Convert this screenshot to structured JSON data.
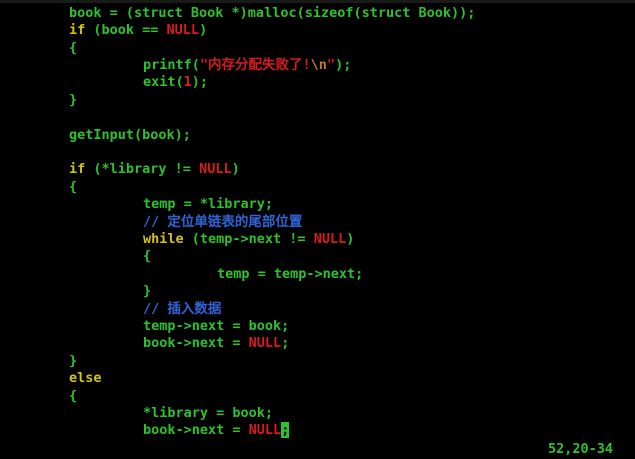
{
  "editor": {
    "lines": [
      {
        "segments": [
          {
            "t": "book = (struct Book *)malloc(",
            "c": "kw-green"
          },
          {
            "t": "sizeof",
            "c": "kw-green"
          },
          {
            "t": "(struct Book));",
            "c": "kw-green"
          }
        ]
      },
      {
        "segments": [
          {
            "t": "if",
            "c": "kw-yellow"
          },
          {
            "t": " (book == ",
            "c": "kw-green"
          },
          {
            "t": "NULL",
            "c": "null-red"
          },
          {
            "t": ")",
            "c": "kw-green"
          }
        ]
      },
      {
        "segments": [
          {
            "t": "{",
            "c": "kw-green"
          }
        ]
      },
      {
        "segments": [
          {
            "t": "printf(",
            "c": "kw-green"
          },
          {
            "t": "\"内存分配失败了!",
            "c": "str-red"
          },
          {
            "t": "\\n",
            "c": "esc"
          },
          {
            "t": "\"",
            "c": "str-red"
          },
          {
            "t": ");",
            "c": "kw-green"
          }
        ]
      },
      {
        "segments": [
          {
            "t": "exit(",
            "c": "kw-green"
          },
          {
            "t": "1",
            "c": "num"
          },
          {
            "t": ");",
            "c": "kw-green"
          }
        ]
      },
      {
        "segments": [
          {
            "t": "}",
            "c": "kw-green"
          }
        ]
      },
      {
        "segments": []
      },
      {
        "segments": [
          {
            "t": "getInput(book);",
            "c": "kw-green"
          }
        ]
      },
      {
        "segments": []
      },
      {
        "segments": [
          {
            "t": "if",
            "c": "kw-yellow"
          },
          {
            "t": " (*library != ",
            "c": "kw-green"
          },
          {
            "t": "NULL",
            "c": "null-red"
          },
          {
            "t": ")",
            "c": "kw-green"
          }
        ]
      },
      {
        "segments": [
          {
            "t": "{",
            "c": "kw-green"
          }
        ]
      },
      {
        "segments": [
          {
            "t": "temp = *library;",
            "c": "kw-green"
          }
        ]
      },
      {
        "segments": [
          {
            "t": "// 定位单链表的尾部位置",
            "c": "comment"
          }
        ]
      },
      {
        "segments": [
          {
            "t": "while",
            "c": "kw-yellow"
          },
          {
            "t": " (temp->next != ",
            "c": "kw-green"
          },
          {
            "t": "NULL",
            "c": "null-red"
          },
          {
            "t": ")",
            "c": "kw-green"
          }
        ]
      },
      {
        "segments": [
          {
            "t": "{",
            "c": "kw-green"
          }
        ]
      },
      {
        "segments": [
          {
            "t": "temp = temp->next;",
            "c": "kw-green"
          }
        ]
      },
      {
        "segments": [
          {
            "t": "}",
            "c": "kw-green"
          }
        ]
      },
      {
        "segments": [
          {
            "t": "// 插入数据",
            "c": "comment"
          }
        ]
      },
      {
        "segments": [
          {
            "t": "temp->next = book;",
            "c": "kw-green"
          }
        ]
      },
      {
        "segments": [
          {
            "t": "book->next = ",
            "c": "kw-green"
          },
          {
            "t": "NULL",
            "c": "null-red"
          },
          {
            "t": ";",
            "c": "kw-green"
          }
        ]
      },
      {
        "segments": [
          {
            "t": "}",
            "c": "kw-green"
          }
        ]
      },
      {
        "segments": [
          {
            "t": "else",
            "c": "kw-yellow"
          }
        ]
      },
      {
        "segments": [
          {
            "t": "{",
            "c": "kw-green"
          }
        ]
      },
      {
        "segments": [
          {
            "t": "*library = book;",
            "c": "kw-green"
          }
        ]
      },
      {
        "segments": [
          {
            "t": "book->next = ",
            "c": "kw-green"
          },
          {
            "t": "NULL",
            "c": "null-red"
          },
          {
            "t": ";",
            "c": "cursor"
          }
        ]
      }
    ]
  },
  "status": {
    "ruler": "52,20-34"
  },
  "colors": {
    "background": "#000000",
    "code": "#2ec22e",
    "keyword": "#d4c21a",
    "null": "#d81c1c",
    "comment": "#2f64d6"
  }
}
